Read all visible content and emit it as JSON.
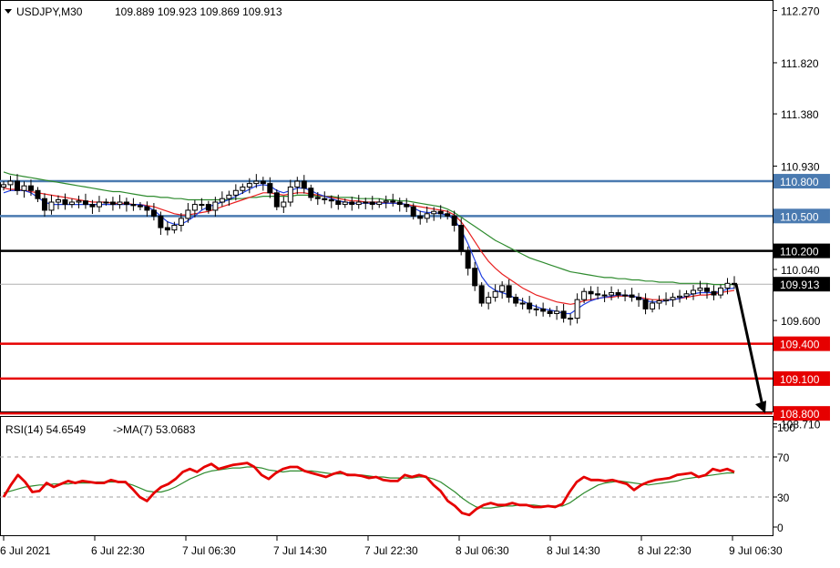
{
  "header": {
    "symbol_label": "USDJPY,M30",
    "ohlc": "109.889 109.923 109.869 109.913",
    "rsi_label": "RSI(14) 54.6549",
    "ma_label": "->MA(7) 53.0683"
  },
  "colors": {
    "frame": "#000000",
    "resistance": "#4a7ab0",
    "pivot": "#000000",
    "support": "#e60000",
    "ma_fast": "#1f3fe0",
    "ma_mid": "#e82020",
    "ma_slow": "#2e8b2e",
    "rsi": "#e60000",
    "rsi_ma": "#2e8b2e",
    "arrow": "#000000"
  },
  "chart_data": [
    {
      "type": "candlestick",
      "title": "USDJPY,M30",
      "ohlc_last": {
        "open": 109.889,
        "high": 109.923,
        "low": 109.869,
        "close": 109.913
      },
      "y_ticks": [
        "112.270",
        "111.820",
        "111.380",
        "110.930",
        "110.040",
        "109.600",
        "108.710"
      ],
      "ylim": [
        108.71,
        112.48
      ],
      "x_ticks": [
        "6 Jul 2021",
        "6 Jul 22:30",
        "7 Jul 06:30",
        "7 Jul 14:30",
        "7 Jul 22:30",
        "8 Jul 06:30",
        "8 Jul 14:30",
        "8 Jul 22:30",
        "9 Jul 06:30"
      ],
      "levels": [
        {
          "value": 110.8,
          "label": "110.800",
          "kind": "resistance"
        },
        {
          "value": 110.5,
          "label": "110.500",
          "kind": "resistance"
        },
        {
          "value": 110.2,
          "label": "110.200",
          "kind": "pivot"
        },
        {
          "value": 109.4,
          "label": "109.400",
          "kind": "support"
        },
        {
          "value": 109.1,
          "label": "109.100",
          "kind": "support"
        },
        {
          "value": 108.8,
          "label": "108.800",
          "kind": "support"
        }
      ],
      "current_price": {
        "value": 109.913,
        "label": "109.913"
      },
      "close_series": [
        110.77,
        110.8,
        110.72,
        110.76,
        110.72,
        110.65,
        110.55,
        110.62,
        110.64,
        110.6,
        110.62,
        110.63,
        110.6,
        110.58,
        110.62,
        110.62,
        110.6,
        110.62,
        110.6,
        110.59,
        110.58,
        110.55,
        110.5,
        110.4,
        110.38,
        110.42,
        110.48,
        110.55,
        110.6,
        110.6,
        110.55,
        110.62,
        110.65,
        110.68,
        110.72,
        110.75,
        110.78,
        110.8,
        110.78,
        110.7,
        110.58,
        110.62,
        110.75,
        110.8,
        110.74,
        110.66,
        110.65,
        110.64,
        110.63,
        110.6,
        110.62,
        110.6,
        110.62,
        110.62,
        110.6,
        110.62,
        110.63,
        110.62,
        110.6,
        110.58,
        110.5,
        110.48,
        110.52,
        110.54,
        110.52,
        110.5,
        110.42,
        110.2,
        110.05,
        109.9,
        109.75,
        109.8,
        109.85,
        109.9,
        109.8,
        109.75,
        109.75,
        109.7,
        109.7,
        109.68,
        109.66,
        109.68,
        109.62,
        109.62,
        109.78,
        109.85,
        109.83,
        109.82,
        109.82,
        109.84,
        109.82,
        109.82,
        109.8,
        109.78,
        109.7,
        109.75,
        109.77,
        109.78,
        109.8,
        109.81,
        109.83,
        109.86,
        109.88,
        109.85,
        109.82,
        109.88,
        109.92,
        109.91
      ],
      "ma_fast_series": [
        110.7,
        110.72,
        110.72,
        110.72,
        110.7,
        110.66,
        110.62,
        110.6,
        110.6,
        110.6,
        110.6,
        110.6,
        110.6,
        110.6,
        110.6,
        110.6,
        110.6,
        110.6,
        110.6,
        110.6,
        110.6,
        110.58,
        110.55,
        110.5,
        110.45,
        110.43,
        110.43,
        110.46,
        110.5,
        110.55,
        110.58,
        110.6,
        110.62,
        110.64,
        110.67,
        110.7,
        110.73,
        110.76,
        110.77,
        110.76,
        110.72,
        110.7,
        110.72,
        110.74,
        110.74,
        110.72,
        110.69,
        110.67,
        110.65,
        110.63,
        110.62,
        110.61,
        110.61,
        110.61,
        110.61,
        110.61,
        110.61,
        110.61,
        110.61,
        110.6,
        110.57,
        110.54,
        110.53,
        110.53,
        110.52,
        110.51,
        110.47,
        110.38,
        110.26,
        110.12,
        109.98,
        109.9,
        109.86,
        109.84,
        109.82,
        109.79,
        109.77,
        109.74,
        109.72,
        109.7,
        109.69,
        109.68,
        109.66,
        109.66,
        109.7,
        109.74,
        109.77,
        109.79,
        109.8,
        109.81,
        109.82,
        109.82,
        109.81,
        109.8,
        109.77,
        109.76,
        109.76,
        109.77,
        109.78,
        109.79,
        109.81,
        109.83,
        109.84,
        109.84,
        109.84,
        109.85,
        109.87,
        109.88
      ],
      "ma_mid_series": [
        110.74,
        110.73,
        110.73,
        110.72,
        110.71,
        110.7,
        110.69,
        110.68,
        110.67,
        110.66,
        110.65,
        110.64,
        110.63,
        110.62,
        110.62,
        110.62,
        110.61,
        110.61,
        110.61,
        110.6,
        110.6,
        110.59,
        110.58,
        110.56,
        110.54,
        110.52,
        110.51,
        110.51,
        110.52,
        110.53,
        110.54,
        110.56,
        110.58,
        110.6,
        110.62,
        110.64,
        110.66,
        110.68,
        110.7,
        110.7,
        110.69,
        110.68,
        110.69,
        110.7,
        110.7,
        110.69,
        110.68,
        110.67,
        110.66,
        110.65,
        110.64,
        110.63,
        110.63,
        110.62,
        110.62,
        110.62,
        110.61,
        110.61,
        110.61,
        110.6,
        110.59,
        110.58,
        110.57,
        110.56,
        110.55,
        110.54,
        110.51,
        110.45,
        110.37,
        110.28,
        110.19,
        110.11,
        110.05,
        110.0,
        109.96,
        109.92,
        109.88,
        109.85,
        109.82,
        109.8,
        109.78,
        109.76,
        109.75,
        109.74,
        109.75,
        109.77,
        109.78,
        109.79,
        109.8,
        109.8,
        109.81,
        109.81,
        109.81,
        109.8,
        109.79,
        109.78,
        109.78,
        109.78,
        109.78,
        109.79,
        109.8,
        109.81,
        109.82,
        109.82,
        109.83,
        109.84,
        109.85,
        109.86
      ],
      "ma_slow_series": [
        110.88,
        110.86,
        110.85,
        110.84,
        110.83,
        110.82,
        110.81,
        110.8,
        110.79,
        110.78,
        110.77,
        110.76,
        110.75,
        110.74,
        110.73,
        110.72,
        110.71,
        110.71,
        110.7,
        110.69,
        110.68,
        110.67,
        110.67,
        110.66,
        110.66,
        110.65,
        110.65,
        110.64,
        110.64,
        110.64,
        110.64,
        110.64,
        110.64,
        110.64,
        110.65,
        110.65,
        110.66,
        110.66,
        110.67,
        110.67,
        110.67,
        110.67,
        110.67,
        110.68,
        110.68,
        110.68,
        110.67,
        110.67,
        110.67,
        110.66,
        110.66,
        110.66,
        110.65,
        110.65,
        110.65,
        110.65,
        110.64,
        110.64,
        110.63,
        110.63,
        110.62,
        110.61,
        110.6,
        110.59,
        110.58,
        110.56,
        110.53,
        110.49,
        110.45,
        110.41,
        110.37,
        110.33,
        110.29,
        110.26,
        110.23,
        110.2,
        110.17,
        110.14,
        110.12,
        110.1,
        110.08,
        110.06,
        110.04,
        110.02,
        110.01,
        110.0,
        109.99,
        109.98,
        109.97,
        109.97,
        109.96,
        109.96,
        109.95,
        109.95,
        109.94,
        109.94,
        109.93,
        109.93,
        109.93,
        109.92,
        109.92,
        109.92,
        109.92,
        109.92,
        109.91,
        109.91,
        109.91,
        109.91
      ],
      "forecast_arrow": {
        "from": 109.913,
        "to": 108.8
      }
    },
    {
      "type": "line",
      "title": "RSI(14) 54.6549 ->MA(7) 53.0683",
      "y_ticks": [
        "100",
        "70",
        "30",
        "0"
      ],
      "ylim": [
        0,
        100
      ],
      "reference_levels": [
        70,
        30
      ],
      "series": [
        {
          "name": "RSI(14)",
          "values": [
            30,
            42,
            52,
            45,
            35,
            36,
            44,
            40,
            43,
            46,
            44,
            46,
            45,
            44,
            44,
            47,
            45,
            45,
            38,
            30,
            26,
            34,
            40,
            43,
            48,
            55,
            58,
            55,
            60,
            63,
            58,
            60,
            62,
            63,
            64,
            60,
            52,
            48,
            54,
            58,
            60,
            60,
            56,
            54,
            52,
            50,
            53,
            55,
            52,
            52,
            51,
            49,
            50,
            47,
            46,
            46,
            52,
            50,
            52,
            50,
            42,
            36,
            26,
            21,
            14,
            12,
            18,
            22,
            24,
            22,
            22,
            24,
            22,
            22,
            20,
            20,
            21,
            20,
            23,
            35,
            45,
            50,
            47,
            47,
            46,
            47,
            45,
            43,
            37,
            42,
            45,
            47,
            48,
            49,
            52,
            53,
            54,
            50,
            52,
            58,
            56,
            58,
            55
          ]
        },
        {
          "name": "MA(7)",
          "values": [
            34,
            36,
            38,
            40,
            41,
            42,
            42,
            43,
            43,
            43,
            44,
            44,
            44,
            45,
            45,
            45,
            45,
            44,
            42,
            39,
            36,
            35,
            35,
            37,
            40,
            44,
            48,
            51,
            54,
            56,
            57,
            58,
            59,
            59,
            60,
            60,
            59,
            57,
            56,
            55,
            56,
            56,
            56,
            56,
            55,
            54,
            53,
            53,
            53,
            52,
            52,
            51,
            50,
            50,
            49,
            49,
            49,
            49,
            50,
            50,
            48,
            45,
            40,
            35,
            29,
            24,
            20,
            19,
            19,
            20,
            21,
            21,
            22,
            22,
            22,
            21,
            21,
            21,
            21,
            24,
            29,
            34,
            38,
            42,
            44,
            45,
            46,
            45,
            44,
            43,
            42,
            43,
            44,
            45,
            46,
            48,
            49,
            50,
            51,
            52,
            53,
            54,
            54
          ]
        }
      ],
      "x_ticks": [
        "6 Jul 2021",
        "6 Jul 22:30",
        "7 Jul 06:30",
        "7 Jul 14:30",
        "7 Jul 22:30",
        "8 Jul 06:30",
        "8 Jul 14:30",
        "8 Jul 22:30",
        "9 Jul 06:30"
      ]
    }
  ]
}
